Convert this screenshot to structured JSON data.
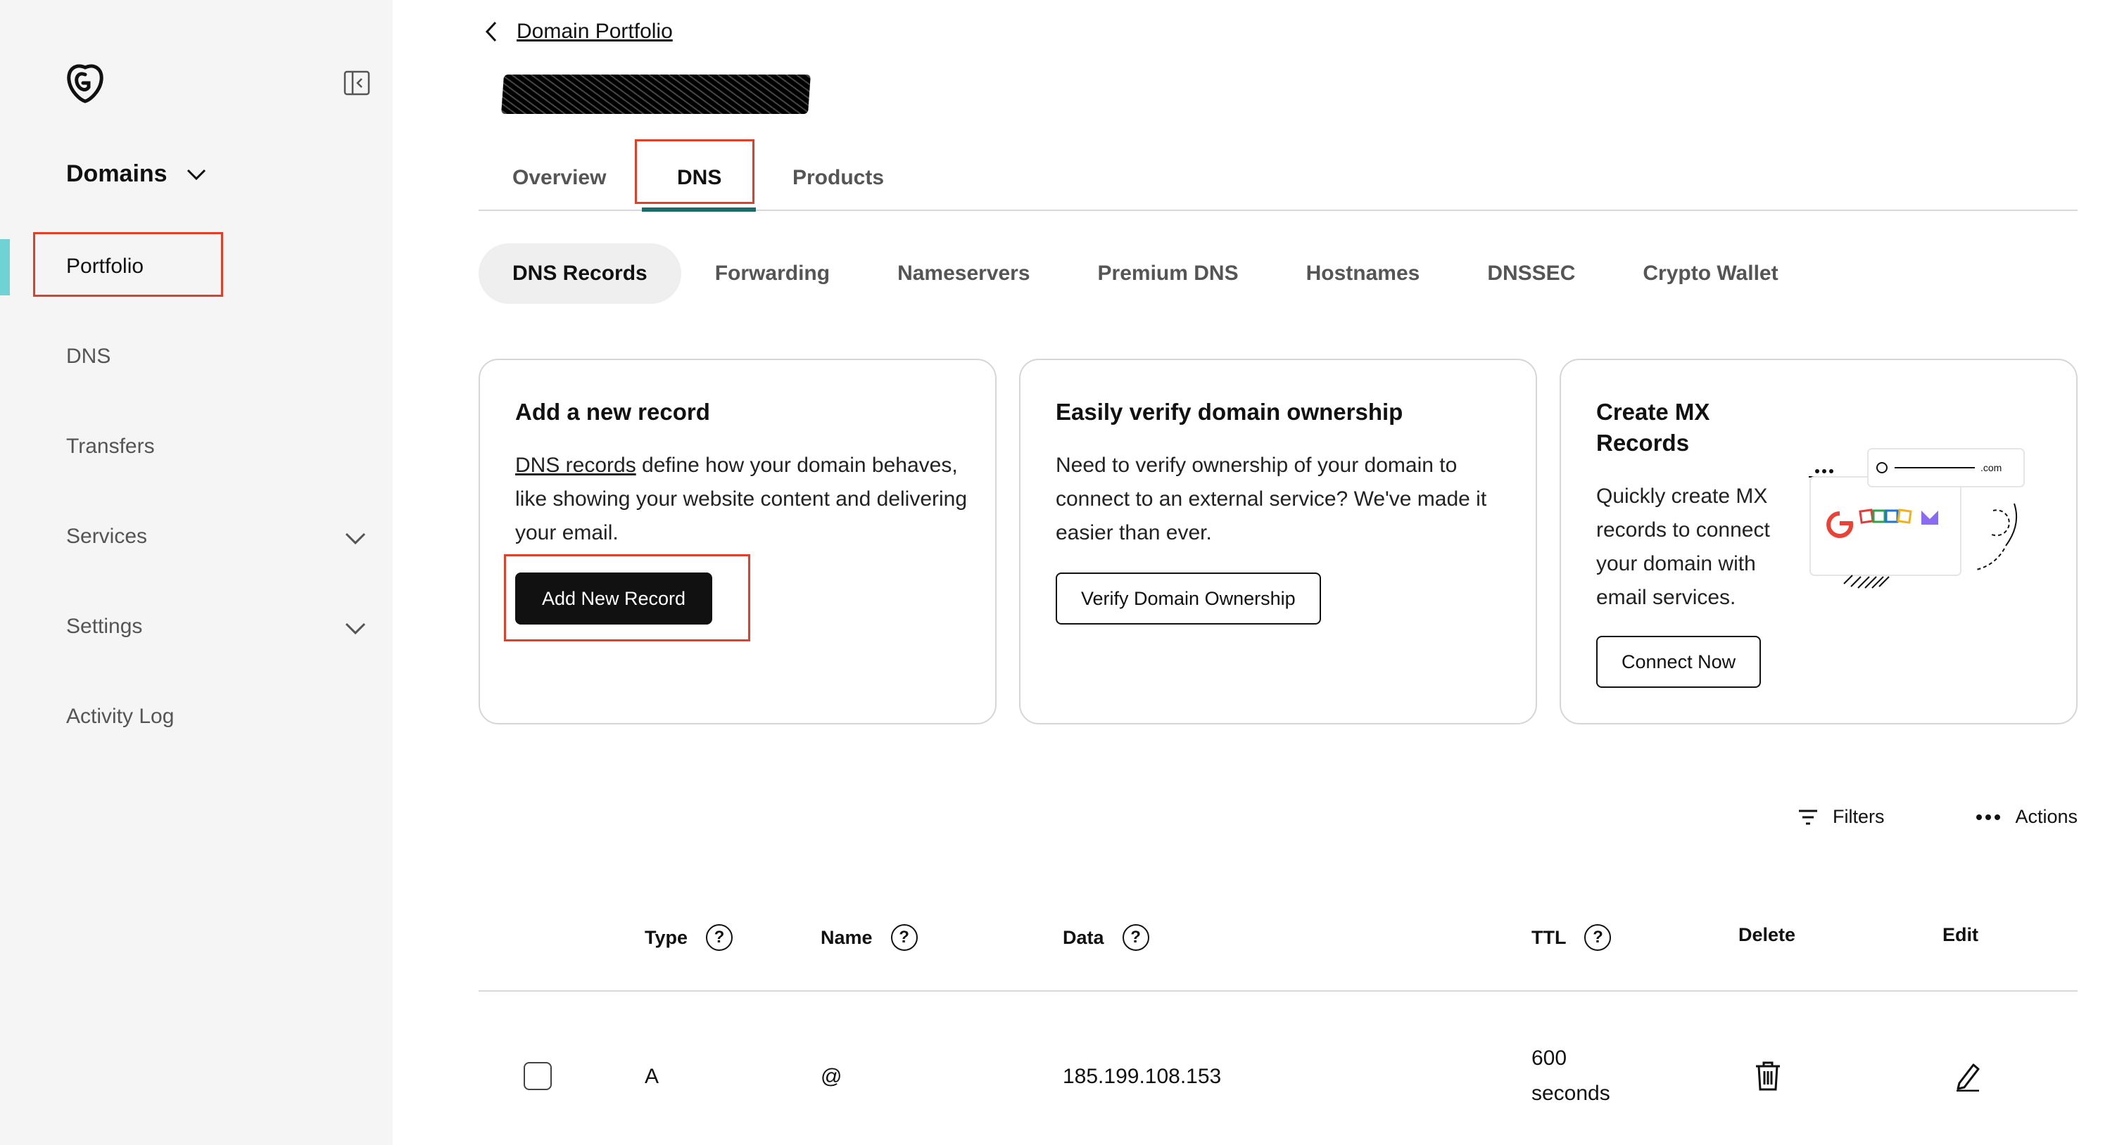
{
  "sidebar": {
    "section_title": "Domains",
    "items": [
      {
        "label": "Portfolio"
      },
      {
        "label": "DNS"
      },
      {
        "label": "Transfers"
      },
      {
        "label": "Services"
      },
      {
        "label": "Settings"
      },
      {
        "label": "Activity Log"
      }
    ]
  },
  "header": {
    "breadcrumb": "Domain Portfolio"
  },
  "tabs": [
    {
      "label": "Overview"
    },
    {
      "label": "DNS"
    },
    {
      "label": "Products"
    }
  ],
  "subtabs": [
    {
      "label": "DNS Records"
    },
    {
      "label": "Forwarding"
    },
    {
      "label": "Nameservers"
    },
    {
      "label": "Premium DNS"
    },
    {
      "label": "Hostnames"
    },
    {
      "label": "DNSSEC"
    },
    {
      "label": "Crypto Wallet"
    }
  ],
  "cards": {
    "add_record": {
      "title": "Add a new record",
      "link_text": "DNS records",
      "body": " define how your domain behaves, like showing your website content and delivering your email.",
      "button": "Add New Record"
    },
    "verify": {
      "title": "Easily verify domain ownership",
      "body": "Need to verify ownership of your domain to connect to an external service? We've made it easier than ever.",
      "button": "Verify Domain Ownership"
    },
    "mx": {
      "title": "Create MX Records",
      "body": "Quickly create MX records to connect your domain with email services.",
      "button": "Connect Now",
      "illustration_text": ".com"
    }
  },
  "table": {
    "toolbar": {
      "filters": "Filters",
      "actions": "Actions"
    },
    "columns": {
      "type": "Type",
      "name": "Name",
      "data": "Data",
      "ttl": "TTL",
      "delete": "Delete",
      "edit": "Edit"
    },
    "help_glyph": "?",
    "rows": [
      {
        "type": "A",
        "name": "@",
        "data": "185.199.108.153",
        "ttl_value": "600",
        "ttl_unit": "seconds"
      }
    ]
  },
  "colors": {
    "highlight": "#e0402a",
    "accent": "#6fd3d3",
    "tab_underline": "#1b6b6b"
  }
}
